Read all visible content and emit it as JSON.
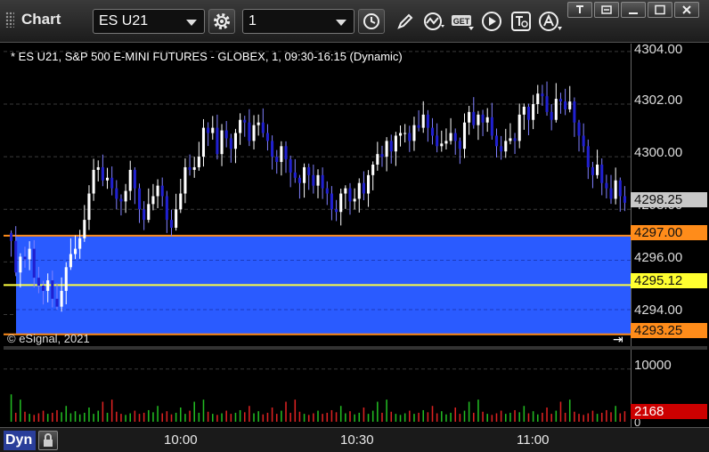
{
  "toolbar": {
    "title": "Chart",
    "symbol": "ES U21",
    "interval": "1"
  },
  "chart": {
    "header": "* ES U21, S&P 500 E-MINI FUTURES - GLOBEX, 1, 09:30-16:15 (Dynamic)",
    "copyright": "© eSignal, 2021"
  },
  "price_scale": {
    "ticks": [
      "4304.00",
      "4302.00",
      "4300.00",
      "4298.00",
      "4296.00",
      "4294.00"
    ],
    "tag_last": "4298.25",
    "tag_upper": "4297.00",
    "tag_mid": "4295.12",
    "tag_lower": "4293.25"
  },
  "volume_scale": {
    "tick_top": "10000",
    "tick_zero": "0",
    "tag_last": "2168"
  },
  "time_axis": {
    "labels": [
      "10:00",
      "10:30",
      "11:00"
    ],
    "mode": "Dyn"
  },
  "colors": {
    "up": "#ffffff",
    "down": "#2020d0",
    "zone": "#2a5bff",
    "zone_edge": "#ff8c1a",
    "midline": "#ffff40",
    "vol_up": "#22bb22",
    "vol_down": "#dd2222"
  },
  "chart_data": {
    "type": "candlestick",
    "symbol": "ES U21",
    "interval_minutes": 1,
    "y_range": [
      4292.8,
      4304.3
    ],
    "x_labels": [
      "10:00",
      "10:30",
      "11:00"
    ],
    "zone": {
      "upper": 4297.0,
      "middle": 4295.12,
      "lower": 4293.25
    },
    "last_price": 4298.25,
    "last_volume": 2168,
    "closes": [
      4296.8,
      4295.6,
      4296.2,
      4296.1,
      4296.5,
      4295.4,
      4295.1,
      4294.9,
      4295.3,
      4294.6,
      4294.3,
      4294.9,
      4295.8,
      4296.3,
      4296.5,
      4296.9,
      4297.6,
      4298.6,
      4299.5,
      4299.6,
      4299.1,
      4299.2,
      4298.8,
      4298.4,
      4298.3,
      4298.7,
      4299.5,
      4298.8,
      4298.0,
      4297.6,
      4298.2,
      4298.5,
      4298.9,
      4298.5,
      4297.6,
      4297.3,
      4298.0,
      4298.6,
      4299.6,
      4299.5,
      4299.6,
      4300.0,
      4301.1,
      4300.9,
      4301.1,
      4300.1,
      4301.0,
      4300.7,
      4300.3,
      4300.9,
      4301.4,
      4301.3,
      4300.6,
      4301.2,
      4301.3,
      4300.9,
      4300.6,
      4300.0,
      4299.8,
      4300.4,
      4299.9,
      4299.4,
      4299.2,
      4299.0,
      4299.6,
      4299.3,
      4298.9,
      4299.3,
      4298.8,
      4298.6,
      4298.0,
      4297.9,
      4298.6,
      4298.8,
      4298.3,
      4298.4,
      4299.0,
      4298.6,
      4299.3,
      4299.7,
      4300.1,
      4300.0,
      4300.6,
      4300.2,
      4300.8,
      4300.9,
      4300.9,
      4300.6,
      4301.2,
      4301.1,
      4301.6,
      4301.1,
      4300.8,
      4300.4,
      4300.5,
      4300.6,
      4300.9,
      4300.6,
      4300.3,
      4301.3,
      4301.7,
      4301.2,
      4301.6,
      4301.3,
      4301.5,
      4300.8,
      4300.4,
      4300.2,
      4300.6,
      4300.7,
      4300.6,
      4301.6,
      4301.9,
      4301.4,
      4302.0,
      4302.4,
      4302.3,
      4301.7,
      4301.4,
      4302.2,
      4302.1,
      4301.8,
      4302.1,
      4301.3,
      4300.8,
      4300.4,
      4299.6,
      4299.3,
      4299.7,
      4299.0,
      4298.8,
      4298.4,
      4299.1,
      4298.5,
      4298.25
    ],
    "volume_shape": [
      3800,
      1700,
      4200,
      1900,
      1500,
      1300,
      1600,
      2100,
      1500,
      1700,
      2200,
      1800,
      3000,
      1600,
      2000,
      1400,
      1700,
      2700,
      1500,
      2100
    ]
  }
}
